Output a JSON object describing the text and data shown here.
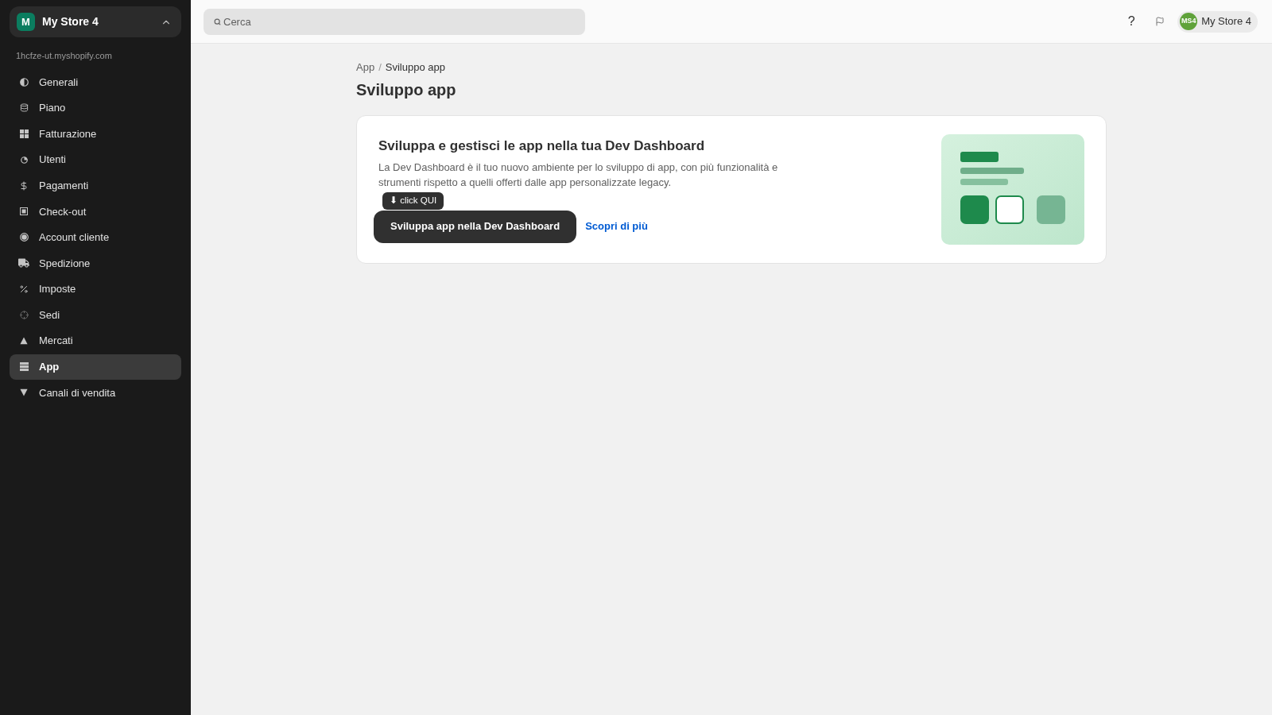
{
  "sidebar": {
    "store": {
      "initial": "M",
      "name": "My Store 4",
      "expanded": true
    },
    "domain": "1hcfze-ut.myshopify.com",
    "items": [
      {
        "label": "Generali",
        "selected": false
      },
      {
        "label": "Piano",
        "selected": false
      },
      {
        "label": "Fatturazione",
        "selected": false
      },
      {
        "label": "Utenti",
        "selected": false
      },
      {
        "label": "Pagamenti",
        "selected": false
      },
      {
        "label": "Check-out",
        "selected": false
      },
      {
        "label": "Account cliente",
        "selected": false
      },
      {
        "label": "Spedizione",
        "selected": false
      },
      {
        "label": "Imposte",
        "selected": false
      },
      {
        "label": "Sedi",
        "selected": false
      },
      {
        "label": "Mercati",
        "selected": false
      },
      {
        "label": "App",
        "selected": true
      },
      {
        "label": "Canali di vendita",
        "selected": false
      }
    ]
  },
  "topbar": {
    "search": {
      "placeholder": "Cerca"
    },
    "help": "?",
    "account": {
      "initials": "MS4",
      "name": "My Store 4"
    }
  },
  "breadcrumb": {
    "items": [
      "App",
      "Sviluppo app"
    ],
    "separator": "/"
  },
  "title": "Sviluppo app",
  "card": {
    "heading": "Sviluppa e gestisci le app nella tua Dev Dashboard",
    "description": "La Dev Dashboard è il tuo nuovo ambiente per lo sviluppo di app, con più funzionalità e strumenti rispetto a quelli offerti dalle app personalizzate legacy.",
    "tooltip": "⬇ click QUI",
    "primary_button": "Sviluppa app nella Dev Dashboard",
    "link": "Scopri di più"
  }
}
